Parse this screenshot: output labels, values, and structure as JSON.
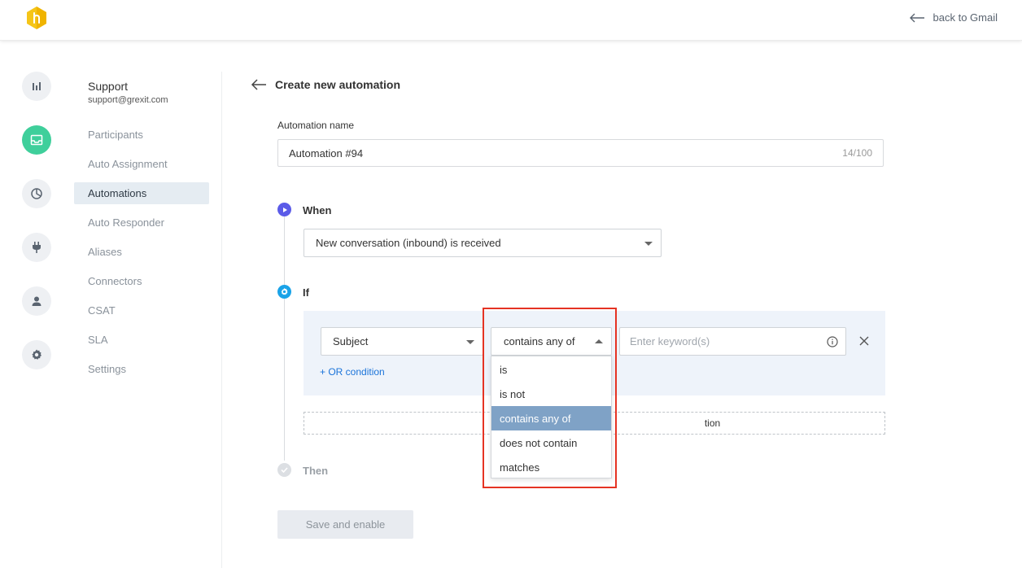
{
  "header": {
    "back_label": "back to Gmail"
  },
  "sidebar": {
    "group_title": "Support",
    "group_email": "support@grexit.com",
    "items": [
      {
        "label": "Participants"
      },
      {
        "label": "Auto Assignment"
      },
      {
        "label": "Automations",
        "active": true
      },
      {
        "label": "Auto Responder"
      },
      {
        "label": "Aliases"
      },
      {
        "label": "Connectors"
      },
      {
        "label": "CSAT"
      },
      {
        "label": "SLA"
      },
      {
        "label": "Settings"
      }
    ]
  },
  "rail_icons": [
    "analytics-icon",
    "inbox-icon",
    "reports-icon",
    "plug-icon",
    "user-icon",
    "gear-icon"
  ],
  "main": {
    "title": "Create new automation",
    "name_label": "Automation name",
    "name_value": "Automation #94",
    "name_counter": "14/100",
    "when": {
      "label": "When",
      "trigger": "New conversation (inbound) is received"
    },
    "if": {
      "label": "If",
      "field": "Subject",
      "operator": "contains any of",
      "keyword_placeholder": "Enter keyword(s)",
      "or_condition": "+ OR condition",
      "add_condition_suffix": "tion"
    },
    "then": {
      "label": "Then"
    },
    "save_button": "Save and enable"
  },
  "operator_dropdown": {
    "options": [
      "is",
      "is not",
      "contains any of",
      "does not contain",
      "matches"
    ],
    "selected": "contains any of"
  },
  "colors": {
    "accent_green": "#3fcf9b",
    "step_purple": "#5b5be8",
    "step_blue": "#1aa3e8",
    "link_blue": "#1a73d9",
    "highlight_red": "#e53323",
    "dropdown_selected": "#7fa2c6"
  }
}
